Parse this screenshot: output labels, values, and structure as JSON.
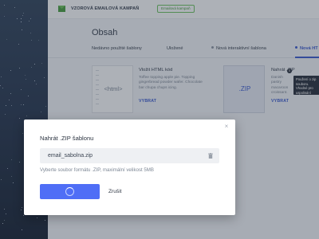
{
  "header": {
    "campaign_title": "VZOROVÁ EMAILOVÁ KAMPAŇ",
    "campaign_badge": "Emailová kampaň"
  },
  "content": {
    "section_title": "Obsah",
    "tabs": [
      {
        "label": "Nedávno použité šablony",
        "active": false
      },
      {
        "label": "Uložené",
        "active": false
      },
      {
        "label": "Nová interaktivní šablona",
        "active": false
      },
      {
        "label": "Nová HT",
        "active": true
      }
    ],
    "templates": [
      {
        "thumb_label": "<html>",
        "name": "Vložit HTML kód",
        "description": "Toffee topping apple pie. Topping gingerbread powder wafer. Chocolate bar chupa chups icing.",
        "action": "VYBRAT"
      },
      {
        "thumb_label": ".ZIP",
        "name": "Nahrát .ZIP",
        "description": "Danish pastry macaroon croissant.",
        "action": "VYBRAT"
      }
    ],
    "tooltip": "Použení o zip souboru. Vhodné pro uspolisání šablon"
  },
  "modal": {
    "title": "Nahrát .ZIP šablonu",
    "file_name": "email_sabolna.zip",
    "hint": "Vyberte soubor formátu .ZIP, maximální velikost 5MB",
    "cancel_label": "Zrušit",
    "upload_state": "loading"
  },
  "colors": {
    "accent": "#4f6ef6",
    "link": "#3d5ccc",
    "badge": "#4a9b44"
  }
}
